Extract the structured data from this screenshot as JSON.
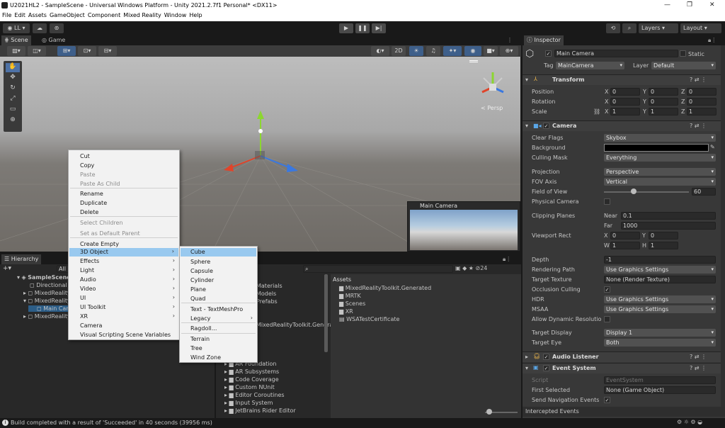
{
  "window": {
    "title": "U2021HL2 - SampleScene - Universal Windows Platform - Unity 2021.2.7f1 Personal* <DX11>",
    "controls": [
      "—",
      "❐",
      "✕"
    ]
  },
  "menu": [
    "File",
    "Edit",
    "Assets",
    "GameObject",
    "Component",
    "Mixed Reality",
    "Window",
    "Help"
  ],
  "toolbar": {
    "account": "LL",
    "layers": "Layers",
    "layout": "Layout",
    "play": "▶",
    "pause": "❚❚",
    "step": "▶|"
  },
  "scene": {
    "tabs": [
      "Scene",
      "Game"
    ],
    "two_d": "2D",
    "persp": "< Persp",
    "camera_preview_title": "Main Camera"
  },
  "context_menu": {
    "items": [
      {
        "label": "Cut",
        "enabled": true
      },
      {
        "label": "Copy",
        "enabled": true
      },
      {
        "label": "Paste",
        "enabled": false
      },
      {
        "label": "Paste As Child",
        "enabled": false
      },
      {
        "label": "Rename",
        "enabled": true
      },
      {
        "label": "Duplicate",
        "enabled": true
      },
      {
        "label": "Delete",
        "enabled": true
      },
      {
        "label": "Select Children",
        "enabled": false
      },
      {
        "label": "Set as Default Parent",
        "enabled": false
      },
      {
        "label": "Create Empty",
        "enabled": true
      },
      {
        "label": "3D Object",
        "enabled": true
      },
      {
        "label": "Effects",
        "enabled": true
      },
      {
        "label": "Light",
        "enabled": true
      },
      {
        "label": "Audio",
        "enabled": true
      },
      {
        "label": "Video",
        "enabled": true
      },
      {
        "label": "UI",
        "enabled": true
      },
      {
        "label": "UI Toolkit",
        "enabled": true
      },
      {
        "label": "XR",
        "enabled": true
      },
      {
        "label": "Camera",
        "enabled": true
      },
      {
        "label": "Visual Scripting Scene Variables",
        "enabled": true
      }
    ]
  },
  "submenu": [
    "Cube",
    "Sphere",
    "Capsule",
    "Cylinder",
    "Plane",
    "Quad",
    "Text - TextMeshPro",
    "Legacy",
    "Ragdoll...",
    "Terrain",
    "Tree",
    "Wind Zone"
  ],
  "hierarchy": {
    "tab": "Hierarchy",
    "search_placeholder": "All",
    "items": [
      "SampleScene",
      "Directional Light",
      "MixedReality",
      "MixedReality",
      "Main Camera",
      "MixedReality"
    ]
  },
  "project": {
    "assets_header": "Assets",
    "count": "24",
    "folders_left": [
      "Materials",
      "Models",
      "Prefabs",
      "MixedRealityToolkit.Generated",
      "AR Foundation",
      "AR Subsystems",
      "Code Coverage",
      "Custom NUnit",
      "Editor Coroutines",
      "Input System",
      "JetBrains Rider Editor"
    ],
    "assets": [
      "MixedRealityToolkit.Generated",
      "MRTK",
      "Scenes",
      "XR",
      "WSATestCertificate"
    ]
  },
  "inspector": {
    "tab": "Inspector",
    "name": "Main Camera",
    "static": "Static",
    "tag_label": "Tag",
    "tag": "MainCamera",
    "layer_label": "Layer",
    "layer": "Default",
    "transform": {
      "title": "Transform",
      "position": [
        "0",
        "0",
        "0"
      ],
      "rotation": [
        "0",
        "0",
        "0"
      ],
      "scale": [
        "1",
        "1",
        "1"
      ],
      "labels": [
        "Position",
        "Rotation",
        "Scale"
      ]
    },
    "camera": {
      "title": "Camera",
      "clear_flags": "Skybox",
      "culling_mask": "Everything",
      "projection": "Perspective",
      "fov_axis": "Vertical",
      "fov": "60",
      "near": "0.1",
      "far": "1000",
      "vx": "0",
      "vy": "0",
      "vw": "1",
      "vh": "1",
      "depth": "-1",
      "rendering_path": "Use Graphics Settings",
      "target_texture": "None (Render Texture)",
      "hdr": "Use Graphics Settings",
      "msaa": "Use Graphics Settings",
      "target_display": "Display 1",
      "target_eye": "Both",
      "labels": [
        "Clear Flags",
        "Background",
        "Culling Mask",
        "Projection",
        "FOV Axis",
        "Field of View",
        "Physical Camera",
        "Clipping Planes",
        "Viewport Rect",
        "Depth",
        "Rendering Path",
        "Target Texture",
        "Occlusion Culling",
        "HDR",
        "MSAA",
        "Allow Dynamic Resolutio",
        "Target Display",
        "Target Eye"
      ]
    },
    "audio_listener": "Audio Listener",
    "event_system": {
      "title": "Event System",
      "script_label": "Script",
      "script": "EventSystem",
      "first_selected_label": "First Selected",
      "first_selected": "None (Game Object)",
      "send_nav_label": "Send Navigation Events"
    },
    "intercepted": "Intercepted Events"
  },
  "status": "Build completed with a result of 'Succeeded' in 40 seconds (39956 ms)"
}
